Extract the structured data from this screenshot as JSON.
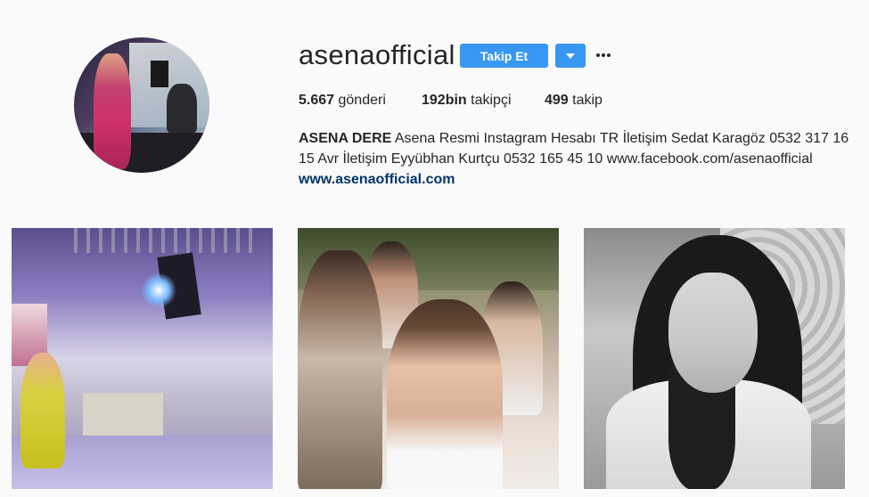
{
  "profile": {
    "username": "asenaofficial",
    "follow_label": "Takip Et",
    "stats": {
      "posts_count": "5.667",
      "posts_label": "gönderi",
      "followers_count": "192bin",
      "followers_label": "takipçi",
      "following_count": "499",
      "following_label": "takip"
    },
    "bio": {
      "name": "ASENA DERE",
      "text": "Asena Resmi Instagram Hesabı TR İletişim Sedat Karagöz 0532 317 16 15 Avr İletişim Eyyübhan Kurtçu 0532 165 45 10 www.facebook.com/asenaofficial",
      "link": "www.asenaofficial.com"
    }
  },
  "icons": {
    "dropdown": "chevron-down-icon",
    "more": "more-options-icon"
  },
  "colors": {
    "accent": "#3897f0",
    "link": "#003569",
    "background": "#fafafa"
  },
  "posts": [
    {
      "description": "stage"
    },
    {
      "description": "selfie"
    },
    {
      "description": "portrait"
    }
  ]
}
